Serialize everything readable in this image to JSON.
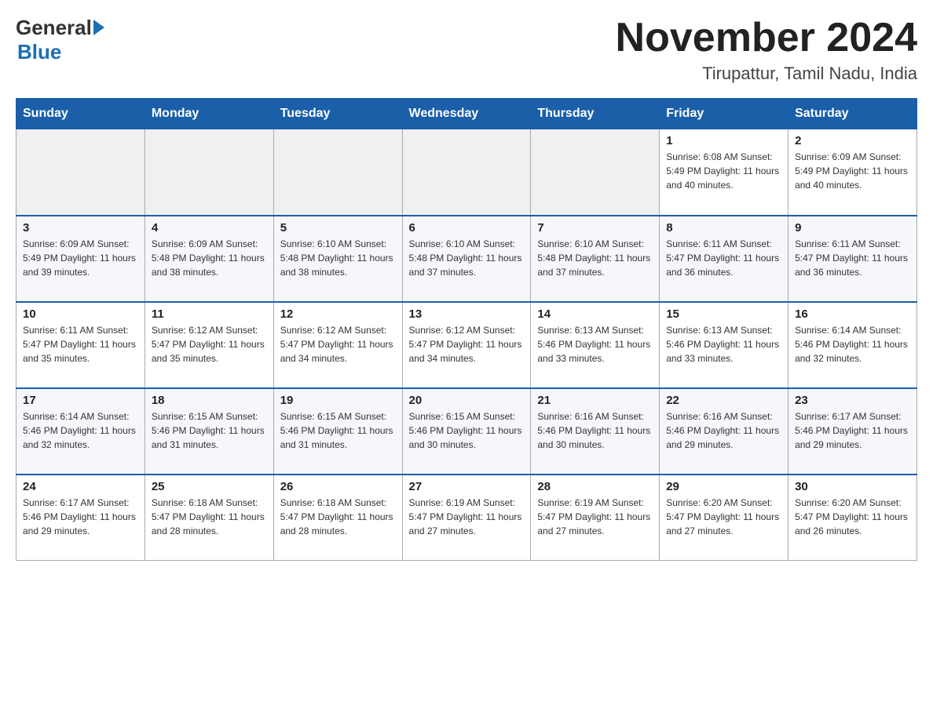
{
  "logo": {
    "text_general": "General",
    "text_blue": "Blue"
  },
  "header": {
    "title": "November 2024",
    "subtitle": "Tirupattur, Tamil Nadu, India"
  },
  "days_of_week": [
    "Sunday",
    "Monday",
    "Tuesday",
    "Wednesday",
    "Thursday",
    "Friday",
    "Saturday"
  ],
  "weeks": [
    [
      {
        "day": "",
        "info": ""
      },
      {
        "day": "",
        "info": ""
      },
      {
        "day": "",
        "info": ""
      },
      {
        "day": "",
        "info": ""
      },
      {
        "day": "",
        "info": ""
      },
      {
        "day": "1",
        "info": "Sunrise: 6:08 AM\nSunset: 5:49 PM\nDaylight: 11 hours and 40 minutes."
      },
      {
        "day": "2",
        "info": "Sunrise: 6:09 AM\nSunset: 5:49 PM\nDaylight: 11 hours and 40 minutes."
      }
    ],
    [
      {
        "day": "3",
        "info": "Sunrise: 6:09 AM\nSunset: 5:49 PM\nDaylight: 11 hours and 39 minutes."
      },
      {
        "day": "4",
        "info": "Sunrise: 6:09 AM\nSunset: 5:48 PM\nDaylight: 11 hours and 38 minutes."
      },
      {
        "day": "5",
        "info": "Sunrise: 6:10 AM\nSunset: 5:48 PM\nDaylight: 11 hours and 38 minutes."
      },
      {
        "day": "6",
        "info": "Sunrise: 6:10 AM\nSunset: 5:48 PM\nDaylight: 11 hours and 37 minutes."
      },
      {
        "day": "7",
        "info": "Sunrise: 6:10 AM\nSunset: 5:48 PM\nDaylight: 11 hours and 37 minutes."
      },
      {
        "day": "8",
        "info": "Sunrise: 6:11 AM\nSunset: 5:47 PM\nDaylight: 11 hours and 36 minutes."
      },
      {
        "day": "9",
        "info": "Sunrise: 6:11 AM\nSunset: 5:47 PM\nDaylight: 11 hours and 36 minutes."
      }
    ],
    [
      {
        "day": "10",
        "info": "Sunrise: 6:11 AM\nSunset: 5:47 PM\nDaylight: 11 hours and 35 minutes."
      },
      {
        "day": "11",
        "info": "Sunrise: 6:12 AM\nSunset: 5:47 PM\nDaylight: 11 hours and 35 minutes."
      },
      {
        "day": "12",
        "info": "Sunrise: 6:12 AM\nSunset: 5:47 PM\nDaylight: 11 hours and 34 minutes."
      },
      {
        "day": "13",
        "info": "Sunrise: 6:12 AM\nSunset: 5:47 PM\nDaylight: 11 hours and 34 minutes."
      },
      {
        "day": "14",
        "info": "Sunrise: 6:13 AM\nSunset: 5:46 PM\nDaylight: 11 hours and 33 minutes."
      },
      {
        "day": "15",
        "info": "Sunrise: 6:13 AM\nSunset: 5:46 PM\nDaylight: 11 hours and 33 minutes."
      },
      {
        "day": "16",
        "info": "Sunrise: 6:14 AM\nSunset: 5:46 PM\nDaylight: 11 hours and 32 minutes."
      }
    ],
    [
      {
        "day": "17",
        "info": "Sunrise: 6:14 AM\nSunset: 5:46 PM\nDaylight: 11 hours and 32 minutes."
      },
      {
        "day": "18",
        "info": "Sunrise: 6:15 AM\nSunset: 5:46 PM\nDaylight: 11 hours and 31 minutes."
      },
      {
        "day": "19",
        "info": "Sunrise: 6:15 AM\nSunset: 5:46 PM\nDaylight: 11 hours and 31 minutes."
      },
      {
        "day": "20",
        "info": "Sunrise: 6:15 AM\nSunset: 5:46 PM\nDaylight: 11 hours and 30 minutes."
      },
      {
        "day": "21",
        "info": "Sunrise: 6:16 AM\nSunset: 5:46 PM\nDaylight: 11 hours and 30 minutes."
      },
      {
        "day": "22",
        "info": "Sunrise: 6:16 AM\nSunset: 5:46 PM\nDaylight: 11 hours and 29 minutes."
      },
      {
        "day": "23",
        "info": "Sunrise: 6:17 AM\nSunset: 5:46 PM\nDaylight: 11 hours and 29 minutes."
      }
    ],
    [
      {
        "day": "24",
        "info": "Sunrise: 6:17 AM\nSunset: 5:46 PM\nDaylight: 11 hours and 29 minutes."
      },
      {
        "day": "25",
        "info": "Sunrise: 6:18 AM\nSunset: 5:47 PM\nDaylight: 11 hours and 28 minutes."
      },
      {
        "day": "26",
        "info": "Sunrise: 6:18 AM\nSunset: 5:47 PM\nDaylight: 11 hours and 28 minutes."
      },
      {
        "day": "27",
        "info": "Sunrise: 6:19 AM\nSunset: 5:47 PM\nDaylight: 11 hours and 27 minutes."
      },
      {
        "day": "28",
        "info": "Sunrise: 6:19 AM\nSunset: 5:47 PM\nDaylight: 11 hours and 27 minutes."
      },
      {
        "day": "29",
        "info": "Sunrise: 6:20 AM\nSunset: 5:47 PM\nDaylight: 11 hours and 27 minutes."
      },
      {
        "day": "30",
        "info": "Sunrise: 6:20 AM\nSunset: 5:47 PM\nDaylight: 11 hours and 26 minutes."
      }
    ]
  ]
}
